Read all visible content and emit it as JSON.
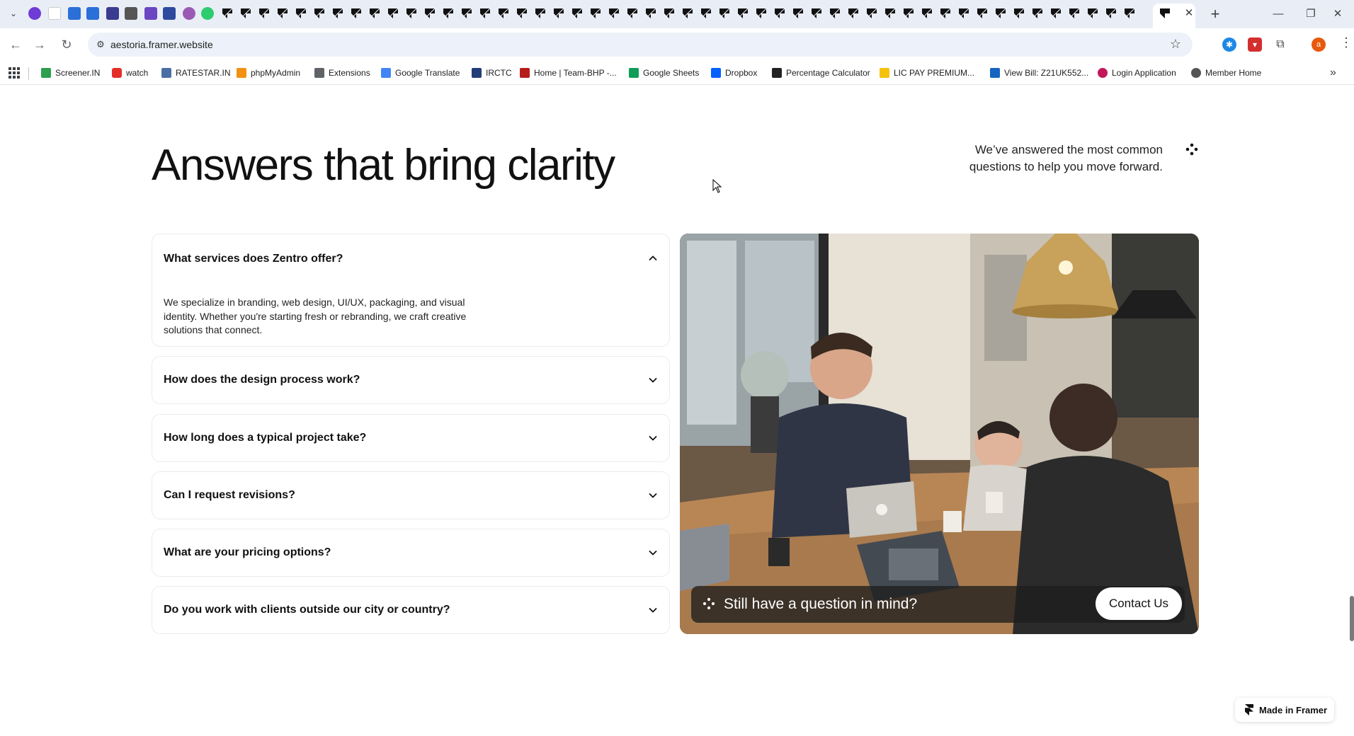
{
  "browser": {
    "url": "aestoria.framer.website",
    "tab_close": "✕",
    "new_tab": "+",
    "profile_initial": "a",
    "bookmarks": [
      {
        "label": "Screener.IN",
        "color": "#2e9e4f"
      },
      {
        "label": "watch",
        "color": "#e52d27"
      },
      {
        "label": "RATESTAR.IN",
        "color": "#4a6fa5"
      },
      {
        "label": "phpMyAdmin",
        "color": "#f29111"
      },
      {
        "label": "Extensions",
        "color": "#5f6368"
      },
      {
        "label": "Google Translate",
        "color": "#4285f4"
      },
      {
        "label": "IRCTC",
        "color": "#213d77"
      },
      {
        "label": "Home | Team-BHP -...",
        "color": "#b71c1c"
      },
      {
        "label": "Google Sheets",
        "color": "#0f9d58"
      },
      {
        "label": "Dropbox",
        "color": "#0061ff"
      },
      {
        "label": "Percentage Calculator",
        "color": "#222222"
      },
      {
        "label": "LIC PAY PREMIUM...",
        "color": "#f4c20d"
      },
      {
        "label": "View Bill: Z21UK552...",
        "color": "#1565c0"
      },
      {
        "label": "Login Application",
        "color": "#c2185b"
      },
      {
        "label": "Member Home",
        "color": "#555555"
      }
    ]
  },
  "page": {
    "heading": "Answers that bring clarity",
    "intro": "We’ve answered the most common questions to help you move forward.",
    "faqs": [
      {
        "question": "What services does Zentro offer?",
        "answer": "We specialize in branding, web design, UI/UX, packaging, and visual identity. Whether you're starting fresh or rebranding, we craft creative solutions that connect.",
        "expanded": true
      },
      {
        "question": "How does the design process work?",
        "expanded": false
      },
      {
        "question": "How long does a typical project take?",
        "expanded": false
      },
      {
        "question": "Can I request revisions?",
        "expanded": false
      },
      {
        "question": "What are your pricing options?",
        "expanded": false
      },
      {
        "question": "Do you work with clients outside our city or country?",
        "expanded": false
      }
    ],
    "cta": {
      "text": "Still have a question in mind?",
      "button": "Contact Us"
    },
    "badge": "Made in Framer"
  },
  "colors": {
    "accent": "#111111",
    "tabstrip": "#e9eef6",
    "omnibox": "#edf2fa"
  }
}
